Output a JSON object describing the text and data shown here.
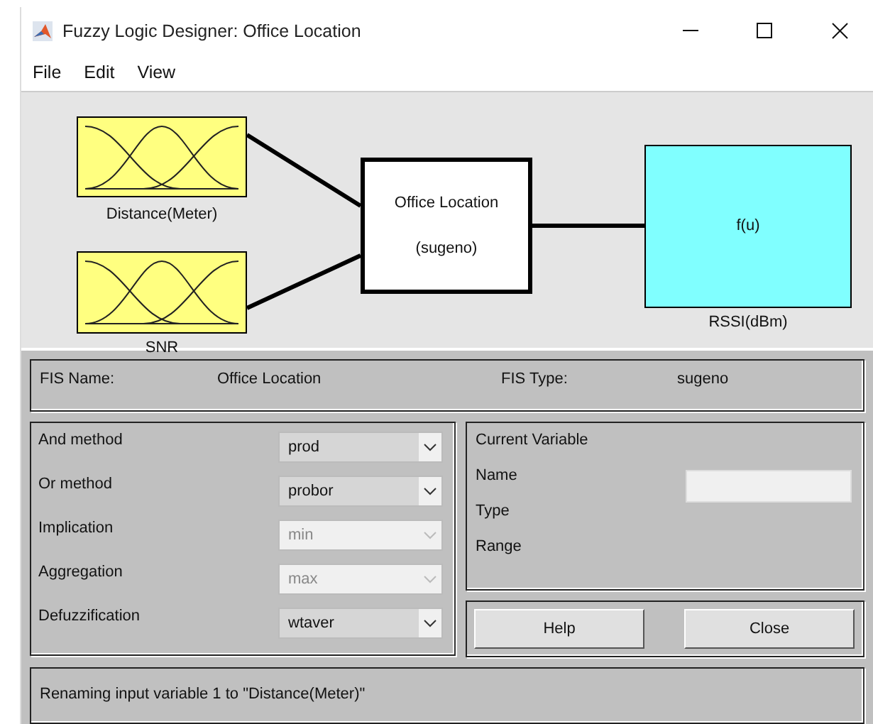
{
  "window": {
    "title": "Fuzzy Logic Designer: Office Location"
  },
  "menu": [
    "File",
    "Edit",
    "View"
  ],
  "diagram": {
    "inputs": [
      {
        "label": "Distance(Meter)"
      },
      {
        "label": "SNR"
      }
    ],
    "system": {
      "name": "Office Location",
      "type": "(sugeno)"
    },
    "output": {
      "symbol": "f(u)",
      "label": "RSSI(dBm)"
    }
  },
  "fis": {
    "name_label": "FIS Name:",
    "name": "Office Location",
    "type_label": "FIS Type:",
    "type": "sugeno"
  },
  "methods": [
    {
      "label": "And method",
      "value": "prod",
      "disabled": false
    },
    {
      "label": "Or method",
      "value": "probor",
      "disabled": false
    },
    {
      "label": "Implication",
      "value": "min",
      "disabled": true
    },
    {
      "label": "Aggregation",
      "value": "max",
      "disabled": true
    },
    {
      "label": "Defuzzification",
      "value": "wtaver",
      "disabled": false
    }
  ],
  "current_variable": {
    "title": "Current Variable",
    "fields": [
      "Name",
      "Type",
      "Range"
    ]
  },
  "buttons": [
    "Help",
    "Close"
  ],
  "status": "Renaming input variable 1 to \"Distance(Meter)\""
}
